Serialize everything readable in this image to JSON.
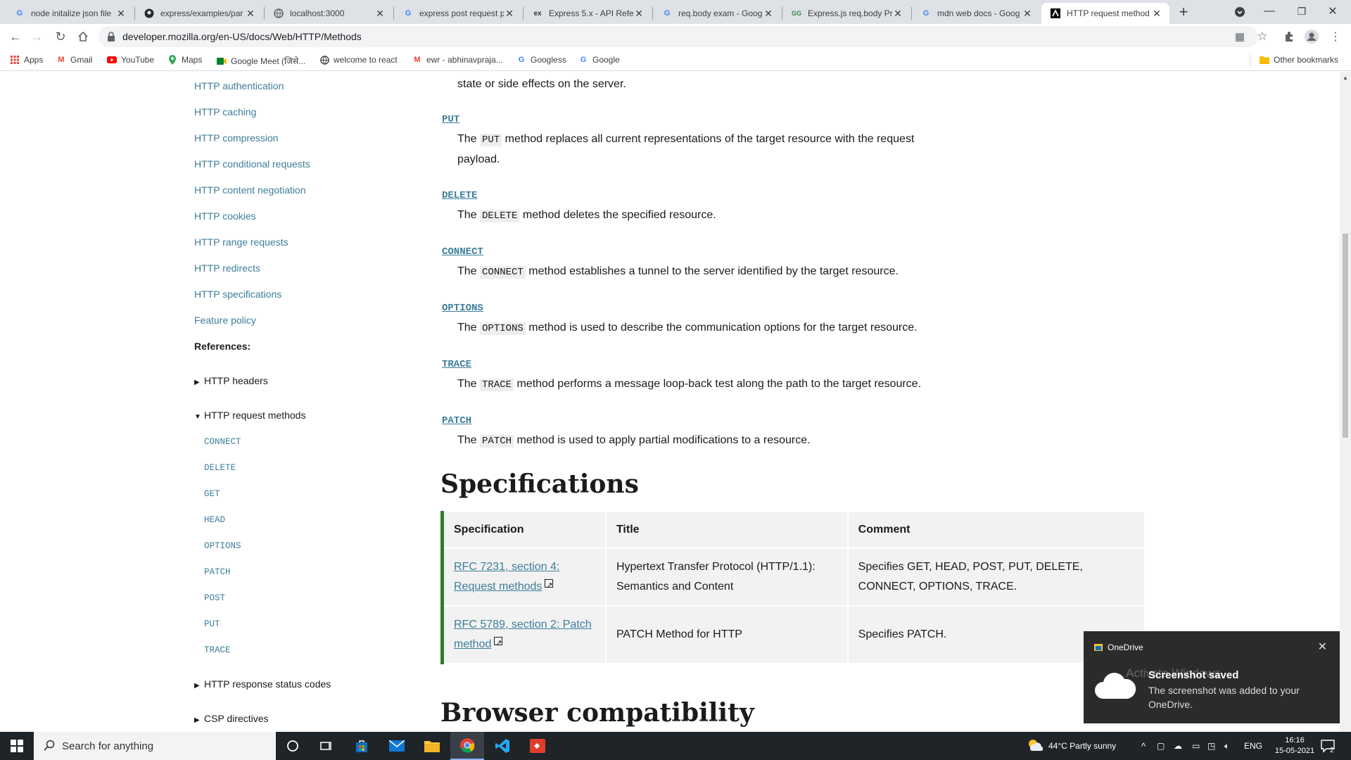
{
  "browser": {
    "tabs": [
      {
        "title": "node initalize json file",
        "favicon": "google-icon"
      },
      {
        "title": "express/examples/par",
        "favicon": "github-icon"
      },
      {
        "title": "localhost:3000",
        "favicon": "globe-icon"
      },
      {
        "title": "express post request p",
        "favicon": "google-icon"
      },
      {
        "title": "Express 5.x - API Refer",
        "favicon": "express-icon"
      },
      {
        "title": "req.body exam - Goog",
        "favicon": "google-icon"
      },
      {
        "title": "Express.js req.body Pr",
        "favicon": "gfg-icon"
      },
      {
        "title": "mdn web docs - Goog",
        "favicon": "google-icon"
      },
      {
        "title": "HTTP request method",
        "favicon": "mdn-icon",
        "active": true
      }
    ],
    "url": "developer.mozilla.org/en-US/docs/Web/HTTP/Methods",
    "bookmarks": [
      {
        "label": "Apps",
        "icon": "apps-grid-icon"
      },
      {
        "label": "Gmail",
        "icon": "gmail-icon"
      },
      {
        "label": "YouTube",
        "icon": "youtube-icon"
      },
      {
        "label": "Maps",
        "icon": "maps-icon"
      },
      {
        "label": "Google Meet (जिसे...",
        "icon": "meet-icon"
      },
      {
        "label": "welcome to react",
        "icon": "globe-icon"
      },
      {
        "label": "ewr - abhinavpraja...",
        "icon": "gmail-icon"
      },
      {
        "label": "Googless",
        "icon": "google-icon"
      },
      {
        "label": "Google",
        "icon": "google-icon"
      }
    ],
    "other_bookmarks": "Other bookmarks"
  },
  "sidebar": {
    "links": [
      "HTTP authentication",
      "HTTP caching",
      "HTTP compression",
      "HTTP conditional requests",
      "HTTP content negotiation",
      "HTTP cookies",
      "HTTP range requests",
      "HTTP redirects",
      "HTTP specifications",
      "Feature policy"
    ],
    "references_heading": "References:",
    "tree": {
      "headers": "HTTP headers",
      "methods": "HTTP request methods",
      "methods_children": [
        "CONNECT",
        "DELETE",
        "GET",
        "HEAD",
        "OPTIONS",
        "PATCH",
        "POST",
        "PUT",
        "TRACE"
      ],
      "status": "HTTP response status codes",
      "csp": "CSP directives"
    }
  },
  "content": {
    "top_text": "state or side effects on the server.",
    "methods": [
      {
        "name": "PUT",
        "pre": "The ",
        "code": "PUT",
        "post": " method replaces all current representations of the target resource with the request payload."
      },
      {
        "name": "DELETE",
        "pre": "The ",
        "code": "DELETE",
        "post": " method deletes the specified resource."
      },
      {
        "name": "CONNECT",
        "pre": "The ",
        "code": "CONNECT",
        "post": " method establishes a tunnel to the server identified by the target resource."
      },
      {
        "name": "OPTIONS",
        "pre": "The ",
        "code": "OPTIONS",
        "post": " method is used to describe the communication options for the target resource."
      },
      {
        "name": "TRACE",
        "pre": "The ",
        "code": "TRACE",
        "post": " method performs a message loop-back test along the path to the target resource."
      },
      {
        "name": "PATCH",
        "pre": "The ",
        "code": "PATCH",
        "post": " method is used to apply partial modifications to a resource."
      }
    ],
    "spec_heading": "Specifications",
    "spec_table": {
      "headers": [
        "Specification",
        "Title",
        "Comment"
      ],
      "rows": [
        {
          "spec": "RFC 7231, section 4: Request methods",
          "title": "Hypertext Transfer Protocol (HTTP/1.1): Semantics and Content",
          "comment": "Specifies GET, HEAD, POST, PUT, DELETE, CONNECT, OPTIONS, TRACE."
        },
        {
          "spec": "RFC 5789, section 2: Patch method",
          "title": "PATCH Method for HTTP",
          "comment": "Specifies PATCH."
        }
      ]
    },
    "compat_heading": "Browser compatibility"
  },
  "toast": {
    "app": "OneDrive",
    "title": "Screenshot saved",
    "body": "The screenshot was added to your OneDrive.",
    "ghost": "Activate Windows"
  },
  "taskbar": {
    "search_placeholder": "Search for anything",
    "weather": "44°C  Partly sunny",
    "lang": "ENG",
    "time": "16:16",
    "date": "15-05-2021",
    "notification_count": "2"
  },
  "colors": {
    "link": "#3d7e9a",
    "spec_border": "#2e7d32",
    "tabstrip": "#dee1e6"
  }
}
